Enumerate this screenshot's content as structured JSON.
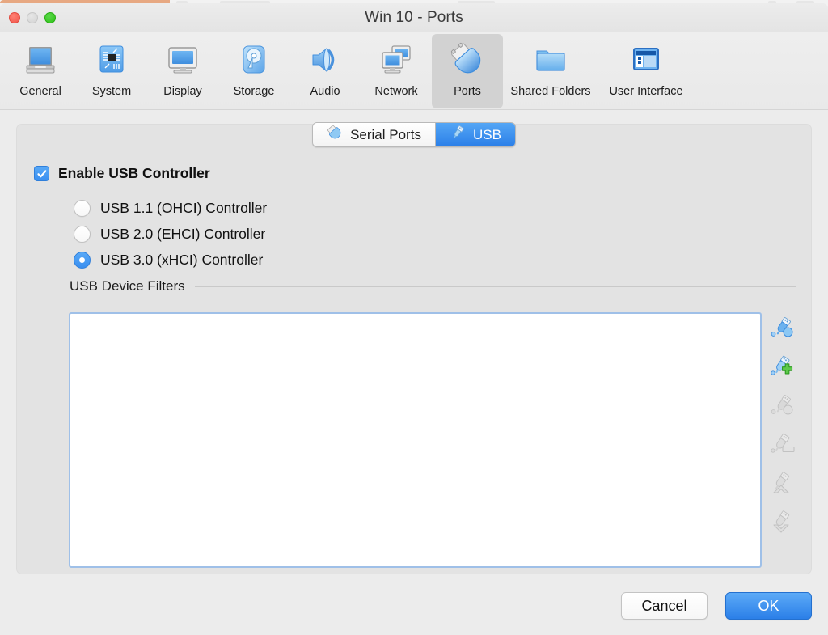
{
  "window": {
    "title": "Win 10 - Ports",
    "traffic_lights": [
      {
        "name": "close",
        "color": "#f0564b"
      },
      {
        "name": "minimize",
        "color": "#d3d3d3"
      },
      {
        "name": "zoom",
        "color": "#2dc016"
      }
    ]
  },
  "toolbar": {
    "items": [
      {
        "label": "General",
        "icon": "computer-icon",
        "selected": false
      },
      {
        "label": "System",
        "icon": "motherboard-icon",
        "selected": false
      },
      {
        "label": "Display",
        "icon": "monitor-icon",
        "selected": false
      },
      {
        "label": "Storage",
        "icon": "harddisk-icon",
        "selected": false
      },
      {
        "label": "Audio",
        "icon": "speaker-icon",
        "selected": false
      },
      {
        "label": "Network",
        "icon": "network-icon",
        "selected": false
      },
      {
        "label": "Ports",
        "icon": "ports-icon",
        "selected": true
      },
      {
        "label": "Shared Folders",
        "icon": "folder-icon",
        "selected": false
      },
      {
        "label": "User Interface",
        "icon": "user-interface-icon",
        "selected": false
      }
    ]
  },
  "tabs": [
    {
      "label": "Serial Ports",
      "icon": "serial-port-icon",
      "active": false
    },
    {
      "label": "USB",
      "icon": "usb-plug-icon",
      "active": true
    }
  ],
  "usb": {
    "enable_checkbox": {
      "label": "Enable USB Controller",
      "checked": true
    },
    "controllers": [
      {
        "label": "USB 1.1 (OHCI) Controller",
        "selected": false
      },
      {
        "label": "USB 2.0 (EHCI) Controller",
        "selected": false
      },
      {
        "label": "USB 3.0 (xHCI) Controller",
        "selected": true
      }
    ],
    "filters_section_title": "USB Device Filters",
    "filters": [],
    "filter_tools": [
      {
        "name": "add-filter-from-device-icon",
        "enabled": true
      },
      {
        "name": "add-new-filter-icon",
        "enabled": true
      },
      {
        "name": "edit-filter-icon",
        "enabled": false
      },
      {
        "name": "remove-filter-icon",
        "enabled": false
      },
      {
        "name": "move-filter-up-icon",
        "enabled": false
      },
      {
        "name": "move-filter-down-icon",
        "enabled": false
      }
    ]
  },
  "buttons": {
    "cancel": "Cancel",
    "ok": "OK"
  },
  "colors": {
    "accent_blue": "#2b7fe8",
    "panel_gray": "#e3e3e3",
    "window_gray": "#ececec",
    "focus_border": "#9fc0e8"
  }
}
